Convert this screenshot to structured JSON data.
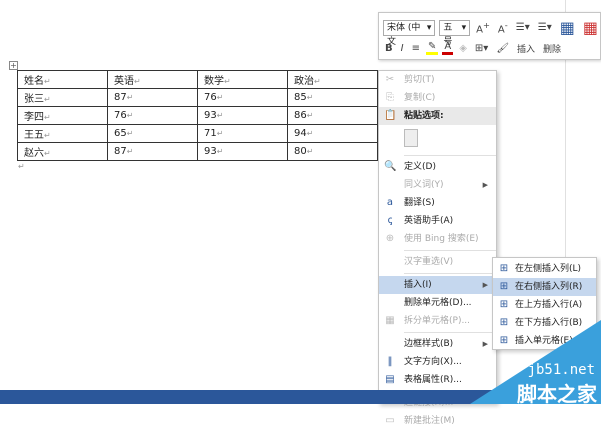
{
  "table": {
    "rows": [
      [
        "姓名",
        "英语",
        "数学",
        "政治"
      ],
      [
        "张三",
        "87",
        "76",
        "85"
      ],
      [
        "李四",
        "76",
        "93",
        "86"
      ],
      [
        "王五",
        "65",
        "71",
        "94"
      ],
      [
        "赵六",
        "87",
        "93",
        "80"
      ]
    ]
  },
  "mini_toolbar": {
    "font": "宋体 (中文",
    "size": "五号",
    "insert": "插入",
    "delete": "删除"
  },
  "menu": {
    "items": [
      {
        "label": "剪切(T)",
        "icon": "scissors-icon",
        "ic": "✂",
        "dis": true
      },
      {
        "label": "复制(C)",
        "icon": "copy-icon",
        "ic": "⎘",
        "dis": true
      },
      {
        "label": "粘贴选项:",
        "icon": "paste-icon",
        "ic": "📋",
        "hdr": true
      },
      {
        "paste": true
      },
      {
        "sep": true
      },
      {
        "label": "定义(D)",
        "icon": "define-icon",
        "ic": "🔍"
      },
      {
        "label": "同义词(Y)",
        "dis": true,
        "sub": true
      },
      {
        "label": "翻译(S)",
        "icon": "translate-icon",
        "ic": "a"
      },
      {
        "label": "英语助手(A)",
        "icon": "english-assistant-icon",
        "ic": "ꞔ"
      },
      {
        "label": "使用 Bing 搜索(E)",
        "icon": "bing-search-icon",
        "ic": "⊕",
        "dis": true
      },
      {
        "sep": true
      },
      {
        "label": "汉字重选(V)",
        "dis": true
      },
      {
        "sep": true
      },
      {
        "label": "插入(I)",
        "hl": true,
        "sub": true
      },
      {
        "label": "删除单元格(D)..."
      },
      {
        "label": "拆分单元格(P)...",
        "icon": "split-cells-icon",
        "ic": "▦",
        "dis": true
      },
      {
        "sep": true
      },
      {
        "label": "边框样式(B)",
        "sub": true
      },
      {
        "label": "文字方向(X)...",
        "icon": "text-direction-icon",
        "ic": "‖"
      },
      {
        "label": "表格属性(R)...",
        "icon": "table-properties-icon",
        "ic": "▤"
      },
      {
        "sep": true
      },
      {
        "label": "超链接(H)...",
        "icon": "hyperlink-icon",
        "ic": "∞",
        "dis": true
      },
      {
        "label": "新建批注(M)",
        "icon": "new-comment-icon",
        "ic": "▭",
        "dis": true
      }
    ]
  },
  "submenu": {
    "items": [
      {
        "label": "在左侧插入列(L)",
        "icon": "insert-column-left-icon",
        "ic": "⊞"
      },
      {
        "label": "在右侧插入列(R)",
        "icon": "insert-column-right-icon",
        "ic": "⊞",
        "hl": true
      },
      {
        "label": "在上方插入行(A)",
        "icon": "insert-row-above-icon",
        "ic": "⊞"
      },
      {
        "label": "在下方插入行(B)",
        "icon": "insert-row-below-icon",
        "ic": "⊞"
      },
      {
        "label": "插入单元格(E)...",
        "icon": "insert-cells-icon",
        "ic": "⊞"
      }
    ]
  },
  "watermark": {
    "site": "jb51.net",
    "name": "脚本之家"
  }
}
